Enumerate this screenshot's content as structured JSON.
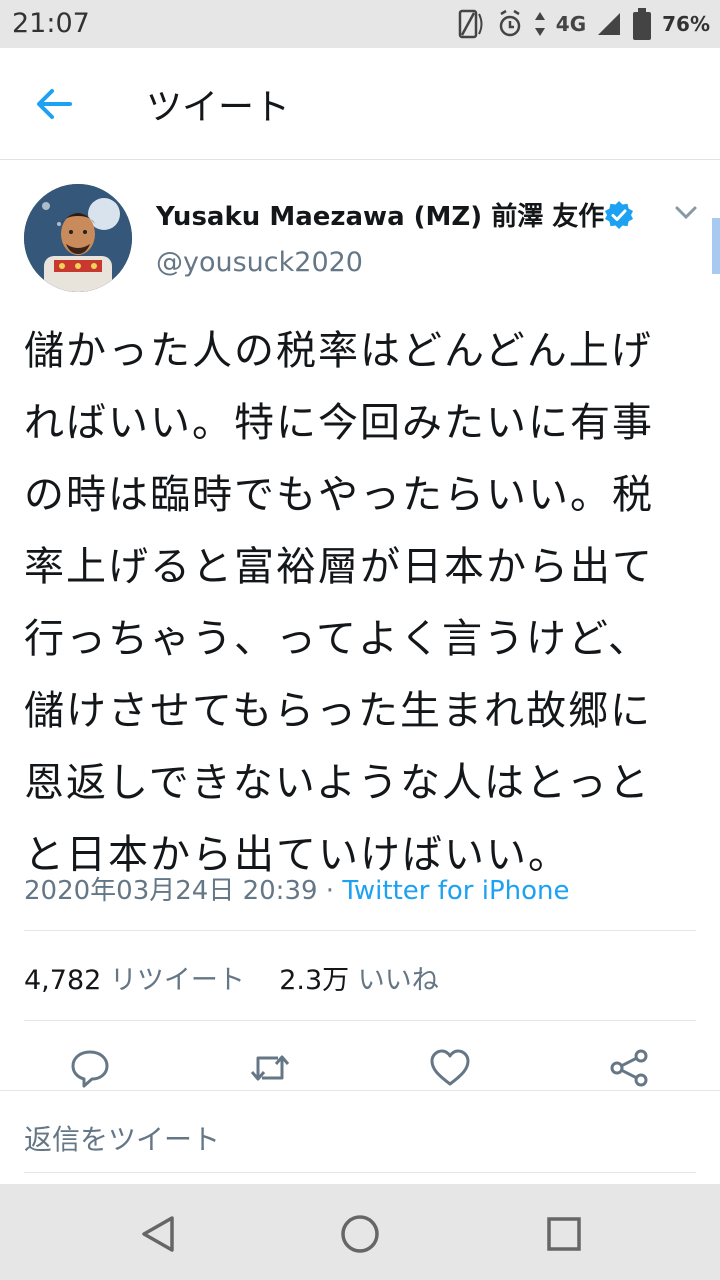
{
  "status_bar": {
    "time": "21:07",
    "network": "4G",
    "battery": "76%",
    "icons": [
      "screen-rotate-icon",
      "alarm-icon",
      "data-arrows-icon",
      "signal-icon",
      "battery-icon"
    ]
  },
  "header": {
    "back_icon": "arrow-left-icon",
    "title": "ツイート"
  },
  "tweet": {
    "author_name": "Yusaku Maezawa (MZ) 前澤 友作",
    "verified": true,
    "handle": "@yousuck2020",
    "lines": [
      "儲かった人の税率はどんどん上げ",
      "ればいい。特に今回みたいに有事",
      "の時は臨時でもやったらいい。税",
      "率上げると富裕層が日本から出て",
      "行っちゃう、ってよく言うけど、",
      "儲けさせてもらった生まれ故郷に",
      "恩返しできないような人はとっと",
      "と日本から出ていけばいい。"
    ],
    "timestamp": "2020年03月24日 20:39",
    "separator": " · ",
    "source": "Twitter for iPhone"
  },
  "stats": {
    "retweets_count": "4,782",
    "retweets_label": "リツイート",
    "likes_count": "2.3万",
    "likes_label": "いいね"
  },
  "actions": [
    "reply-icon",
    "retweet-icon",
    "like-icon",
    "share-icon"
  ],
  "reply_bar": {
    "placeholder": "返信をツイート"
  },
  "colors": {
    "accent": "#1da1f2",
    "secondary_text": "#657786",
    "primary_text": "#14171a"
  }
}
